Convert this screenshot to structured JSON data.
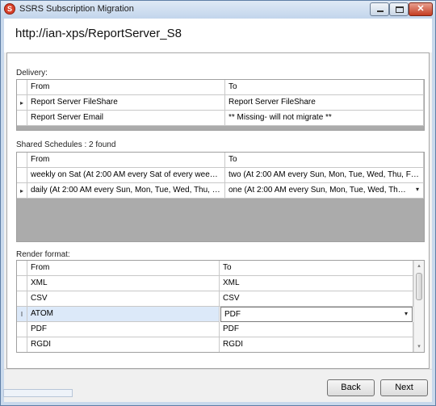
{
  "window": {
    "title": "SSRS Subscription Migration",
    "icon": "ssrs-app-icon",
    "controls": {
      "minimize_icon": "minimize-icon",
      "maximize_icon": "maximize-icon",
      "close_icon": "close-icon",
      "close_glyph": "✕"
    }
  },
  "header": {
    "server_url": "http://ian-xps/ReportServer_S8"
  },
  "delivery": {
    "label": "Delivery:",
    "columns": {
      "from": "From",
      "to": "To"
    },
    "rows": [
      {
        "indicator": "▸",
        "from": "Report Server FileShare",
        "to": "Report Server FileShare"
      },
      {
        "indicator": "",
        "from": "Report Server Email",
        "to": "** Missing- will not migrate **"
      }
    ]
  },
  "schedules": {
    "label": "Shared Schedules : 2 found",
    "columns": {
      "from": "From",
      "to": "To"
    },
    "rows": [
      {
        "indicator": "",
        "from": "weekly on Sat (At 2:00 AM every  Sat of every week, sta...",
        "to": "two (At 2:00 AM every  Sun, Mon, Tue, Wed, Thu, Fri, S..."
      },
      {
        "indicator": "▸",
        "from": "daily (At 2:00 AM every  Sun, Mon, Tue, Wed, Thu, Fri, S...",
        "to": "one (At 2:00 AM every  Sun, Mon, Tue, Wed, Thu, Fri...",
        "dropdown_arrow": "▾"
      }
    ]
  },
  "render_format": {
    "label": "Render format:",
    "columns": {
      "from": "From",
      "to": "To"
    },
    "rows": [
      {
        "indicator": "",
        "from": "XML",
        "to": "XML"
      },
      {
        "indicator": "",
        "from": "CSV",
        "to": "CSV"
      },
      {
        "indicator": "I",
        "from": "ATOM",
        "to": "PDF",
        "dropdown_arrow": "▾"
      },
      {
        "indicator": "",
        "from": "PDF",
        "to": "PDF"
      },
      {
        "indicator": "",
        "from": "RGDI",
        "to": "RGDI"
      }
    ],
    "scroll_up": "▴",
    "scroll_down": "▾"
  },
  "footer": {
    "back_label": "Back",
    "next_label": "Next"
  },
  "colors": {
    "titlebar": "#c2d5ec",
    "selected_row": "#dce9f9",
    "close_button": "#c43c22"
  }
}
